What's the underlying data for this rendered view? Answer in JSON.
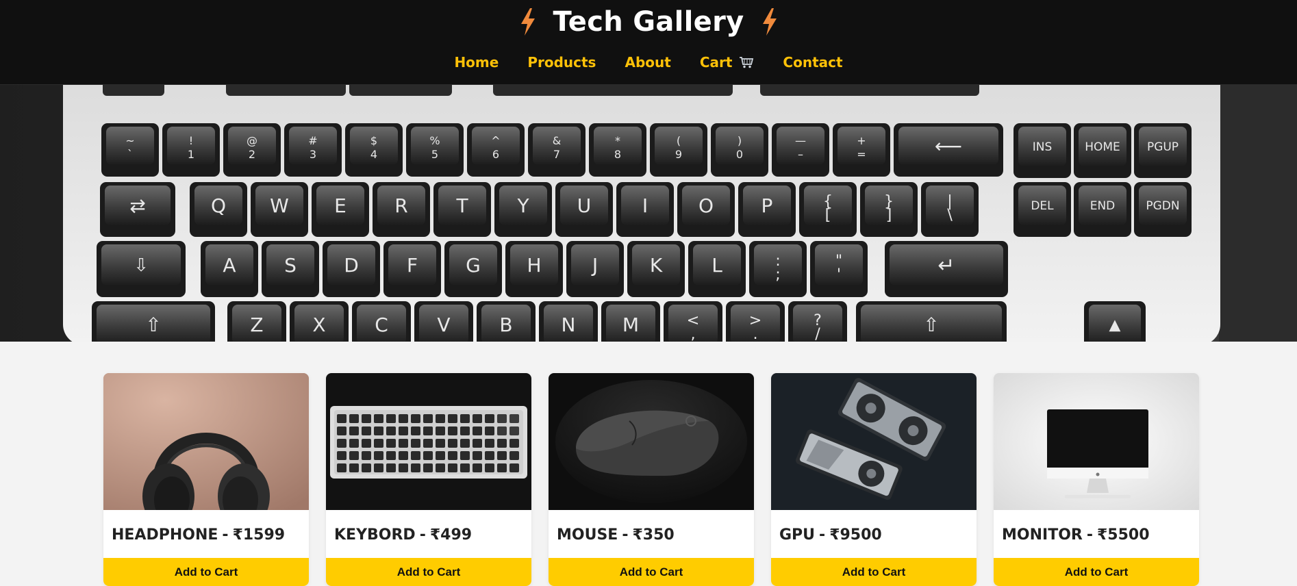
{
  "header": {
    "title": "Tech Gallery",
    "left_icon": "lightning-bolt-icon",
    "right_icon": "lightning-bolt-icon",
    "accent_color": "#ffc107",
    "background_color": "#101010"
  },
  "nav": {
    "items": [
      {
        "label": "Home"
      },
      {
        "label": "Products"
      },
      {
        "label": "About"
      },
      {
        "label": "Cart",
        "icon": "shopping-cart-icon"
      },
      {
        "label": "Contact"
      }
    ]
  },
  "hero": {
    "image": "mechanical-keyboard-photo",
    "keys": {
      "row1": [
        "~\n`",
        "!\n1",
        "@\n2",
        "#\n3",
        "$\n4",
        "%\n5",
        "^\n6",
        "&\n7",
        "*\n8",
        "(\n9",
        ")\n0",
        "—\n–",
        "+\n="
      ],
      "row2": [
        "Q",
        "W",
        "E",
        "R",
        "T",
        "Y",
        "U",
        "I",
        "O",
        "P",
        "{\n[",
        "}\n]",
        "|\n\\"
      ],
      "row3": [
        "A",
        "S",
        "D",
        "F",
        "G",
        "H",
        "J",
        "K",
        "L",
        ":\n;",
        "\"\n'"
      ],
      "row4": [
        "Z",
        "X",
        "C",
        "V",
        "B",
        "N",
        "M",
        "<\n,",
        ">\n.",
        "?\n/"
      ],
      "nav_cluster": [
        "INS",
        "HOME",
        "PGUP",
        "DEL",
        "END",
        "PGDN"
      ]
    }
  },
  "products": [
    {
      "name": "HEADPHONE",
      "separator": "-",
      "price": "₹1599",
      "button": "Add to Cart",
      "image": "headphones-photo"
    },
    {
      "name": "KEYBORD",
      "separator": "-",
      "price": "₹499",
      "button": "Add to Cart",
      "image": "keyboard-photo"
    },
    {
      "name": "MOUSE",
      "separator": "-",
      "price": "₹350",
      "button": "Add to Cart",
      "image": "mouse-photo"
    },
    {
      "name": "GPU",
      "separator": "-",
      "price": "₹9500",
      "button": "Add to Cart",
      "image": "gpu-photo"
    },
    {
      "name": "MONITOR",
      "separator": "-",
      "price": "₹5500",
      "button": "Add to Cart",
      "image": "monitor-photo"
    }
  ]
}
